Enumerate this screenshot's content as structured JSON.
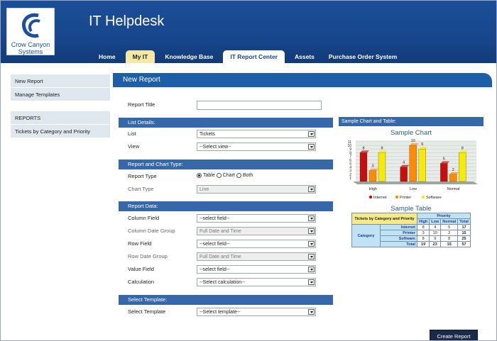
{
  "logo": {
    "line1": "Crow Canyon",
    "line2": "Systems"
  },
  "app_title": "IT Helpdesk",
  "tabs": [
    {
      "label": "Home"
    },
    {
      "label": "My IT"
    },
    {
      "label": "Knowledge Base"
    },
    {
      "label": "IT Report Center"
    },
    {
      "label": "Assets"
    },
    {
      "label": "Purchase Order System"
    }
  ],
  "sidebar": {
    "items": [
      "New Report",
      "Manage Templates"
    ],
    "section": "REPORTS",
    "reports": [
      "Tickets by Category and Priority"
    ]
  },
  "page_title": "New Report",
  "form": {
    "report_title_label": "Report Title",
    "report_title_value": "",
    "list_details": "List Details:",
    "list_label": "List",
    "list_value": "Tickets",
    "view_label": "View",
    "view_value": "--Select view--",
    "report_chart_type": "Report and Chart Type:",
    "report_type_label": "Report Type",
    "radio_table": "Table",
    "radio_chart": "Chart",
    "radio_both": "Both",
    "chart_type_label": "Chart Type",
    "chart_type_value": "Line",
    "report_data": "Report Data:",
    "column_field_label": "Column Field",
    "column_field_value": "--select field--",
    "column_date_group_label": "Column Date Group",
    "column_date_group_value": "Full Date and Time",
    "row_field_label": "Row Field",
    "row_field_value": "--select field--",
    "row_date_group_label": "Row Date Group",
    "row_date_group_value": "Full Date and Time",
    "value_field_label": "Value Field",
    "value_field_value": "--select field--",
    "calculation_label": "Calculation",
    "calculation_value": "--Select calculation--",
    "select_template_hd": "Select Template:",
    "select_template_label": "Select Template",
    "select_template_value": "--Select template--"
  },
  "sample": {
    "header": "Sample Chart and Table:",
    "chart_title": "Sample Chart",
    "table_title": "Sample Table"
  },
  "chart_data": {
    "type": "bar",
    "title": "Sample Chart",
    "categories": [
      "High",
      "Low",
      "Normal"
    ],
    "series": [
      {
        "name": "Internet",
        "values": [
          8,
          4,
          5
        ]
      },
      {
        "name": "Printer",
        "values": [
          3,
          10,
          2
        ]
      },
      {
        "name": "Software",
        "values": [
          8,
          9,
          8
        ]
      }
    ],
    "ylim": [
      0,
      11
    ],
    "yticks": [
      "1",
      "2",
      "3",
      "4",
      "5",
      "6",
      "7",
      "8",
      "9",
      "10",
      "11"
    ],
    "legend": "bottom",
    "colors": {
      "Internet": "#c80f0f",
      "Printer": "#ff8c00",
      "Software": "#f5ea0a"
    }
  },
  "table": {
    "corner": "Tickets by Category and Priority",
    "priority": "Priority",
    "category": "Category",
    "cols": [
      "High",
      "Low",
      "Normal",
      "Total"
    ],
    "rows": [
      {
        "name": "Internet",
        "vals": [
          "8",
          "4",
          "5",
          "17"
        ]
      },
      {
        "name": "Printer",
        "vals": [
          "3",
          "10",
          "2",
          "15"
        ]
      },
      {
        "name": "Software",
        "vals": [
          "8",
          "9",
          "8",
          "25"
        ]
      },
      {
        "name": "Total",
        "vals": [
          "19",
          "23",
          "15",
          "57"
        ]
      }
    ]
  },
  "create_button": "Create Report",
  "colors": {
    "header": "#17468c",
    "accent": "#1d5ea8",
    "section": "#3667a8"
  }
}
